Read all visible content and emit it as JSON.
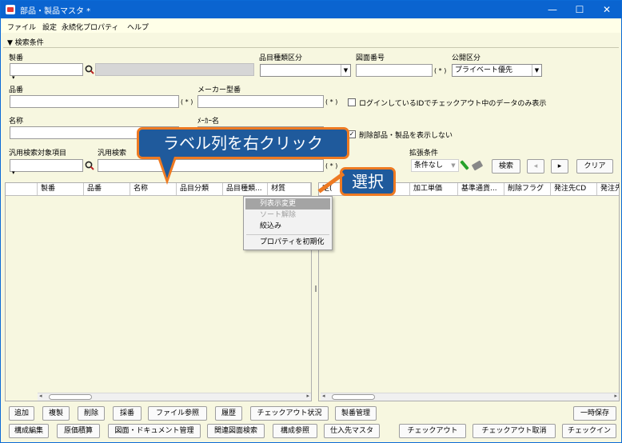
{
  "window": {
    "title": "部品・製品マスタ *",
    "controls": {
      "minimize": "—",
      "maximize": "☐",
      "close": "✕"
    }
  },
  "menu": [
    "ファイル",
    "設定",
    "永続化プロパティ",
    "ヘルプ"
  ],
  "search_section": {
    "heading": "▼ 検索条件"
  },
  "fields": {
    "seiban": {
      "label": "製番"
    },
    "hinmoku_shurui": {
      "label": "品目種類区分",
      "value": ""
    },
    "zumen_bango": {
      "label": "図面番号",
      "required": "( * )"
    },
    "kokai_kubun": {
      "label": "公開区分",
      "value": "プライベート優先"
    },
    "hinban": {
      "label": "品番",
      "required": "( * )"
    },
    "maker_kataban": {
      "label": "メーカー型番",
      "required": "( * )"
    },
    "login_checkout": {
      "label": "ログインしているIDでチェックアウト中のデータのみ表示",
      "checked": false
    },
    "meisho": {
      "label": "名称"
    },
    "maker_name": {
      "label": "ﾒｰｶｰ名"
    },
    "deleted_parts": {
      "label": "削除部品・製品を表示しない",
      "checked": true
    },
    "hanyo_target": {
      "label": "汎用検索対象項目"
    },
    "hanyo_search": {
      "label": "汎用検索",
      "required": "( * )"
    },
    "kakucho": {
      "label": "拡張条件",
      "value": "条件なし"
    }
  },
  "search_buttons": {
    "search": "検索",
    "prev": "◂",
    "next": "▸",
    "clear": "クリア"
  },
  "left_grid": {
    "columns": [
      "製番",
      "品番",
      "名称",
      "品目分類",
      "品目種類...",
      "材質"
    ]
  },
  "right_grid": {
    "columns": [
      "定(",
      "",
      "加工単価",
      "基準通貨...",
      "削除フラグ",
      "発注先CD",
      "発注先"
    ]
  },
  "context_menu": {
    "items": [
      {
        "label": "列表示変更",
        "state": "highlighted"
      },
      {
        "label": "ソート解除",
        "state": "disabled"
      },
      {
        "label": "絞込み",
        "state": "normal"
      },
      {
        "label": "プロパティを初期化",
        "state": "normal"
      }
    ]
  },
  "callouts": {
    "right_click": "ラベル列を右クリック",
    "select": "選択"
  },
  "bottom_row1": [
    "追加",
    "複製",
    "削除",
    "採番",
    "ファイル参照",
    "履歴",
    "チェックアウト状況",
    "製番管理",
    "一時保存"
  ],
  "bottom_row2": [
    "構成編集",
    "原価積算",
    "図面・ドキュメント管理",
    "関連図面検索",
    "構成参照",
    "仕入先マスタ",
    "チェックアウト",
    "チェックアウト取消",
    "チェックイン"
  ],
  "colors": {
    "titlebar": "#0a64d0",
    "panel": "#f7f7e0",
    "callout_fill": "#1f5a9c",
    "callout_border": "#ee7a22"
  }
}
